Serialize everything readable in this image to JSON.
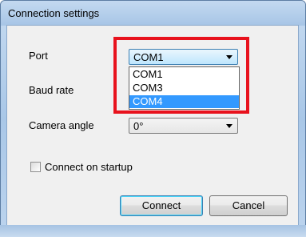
{
  "window": {
    "title": "Connection settings"
  },
  "form": {
    "port_label": "Port",
    "port_value": "COM1",
    "port_options": [
      "COM1",
      "COM3",
      "COM4"
    ],
    "port_selected_option": "COM4",
    "baud_label": "Baud rate",
    "camera_label": "Camera angle",
    "camera_value": "0°",
    "startup_label": "Connect on startup",
    "startup_checked": false
  },
  "buttons": {
    "connect": "Connect",
    "cancel": "Cancel"
  },
  "colors": {
    "highlight": "#e8121d",
    "selection": "#3399ff"
  }
}
